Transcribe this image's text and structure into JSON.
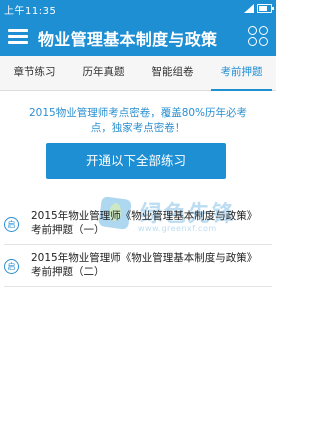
{
  "status_bar": {
    "carrier": "上午11:35"
  },
  "app_bar": {
    "title": "物业管理基本制度与政策"
  },
  "tabs": [
    {
      "label": "章节练习",
      "active": false
    },
    {
      "label": "历年真题",
      "active": false
    },
    {
      "label": "智能组卷",
      "active": false
    },
    {
      "label": "考前押题",
      "active": true
    }
  ],
  "promo": {
    "line1": "2015物业管理师考点密卷，覆盖80%历年必考",
    "line2": "点，独家考点密卷！"
  },
  "cta_label": "开通以下全部练习",
  "papers": [
    {
      "badge": "启",
      "title": "2015年物业管理师《物业管理基本制度与政策》考前押题（一）"
    },
    {
      "badge": "启",
      "title": "2015年物业管理师《物业管理基本制度与政策》考前押题（二）"
    }
  ],
  "watermark": {
    "name": "绿色先锋",
    "url": "www.greenxf.com"
  },
  "colors": {
    "accent": "#1f8fd4",
    "text": "#222222",
    "tab_bg": "#f6f6f6"
  }
}
